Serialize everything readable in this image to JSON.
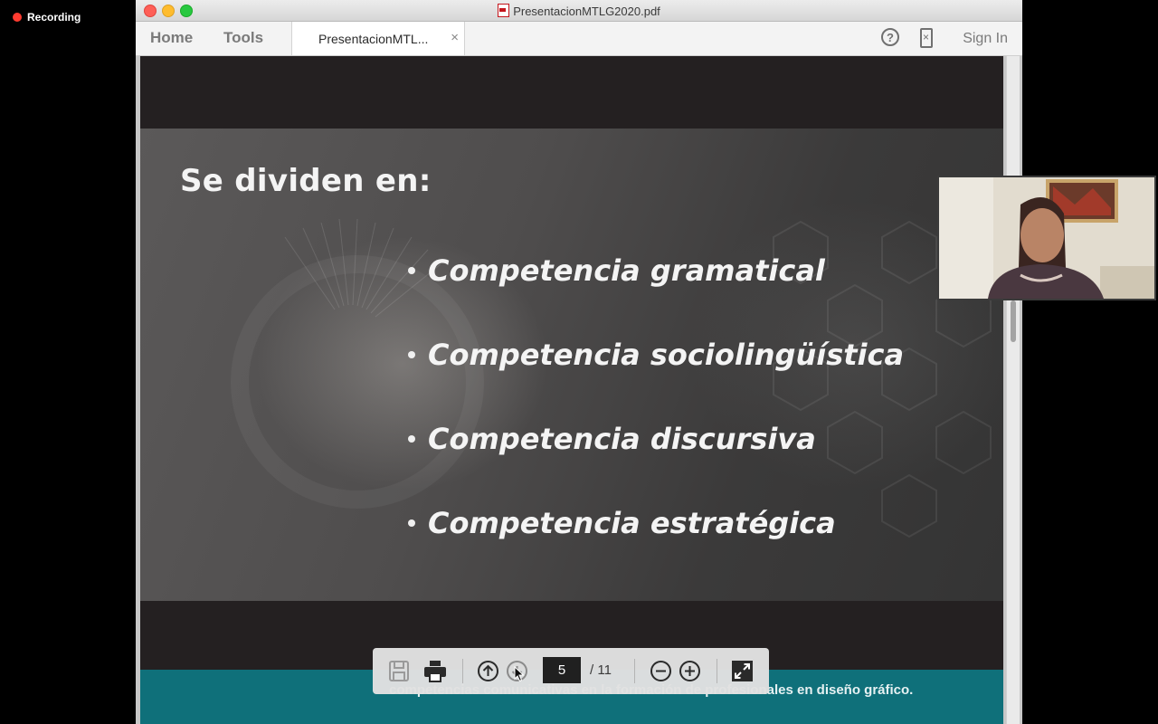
{
  "recording": {
    "label": "Recording"
  },
  "window": {
    "title": "PresentacionMTLG2020.pdf"
  },
  "toolbar": {
    "home_label": "Home",
    "tools_label": "Tools",
    "doc_tab_label": "PresentacionMTL...",
    "doc_tab_close": "×",
    "help_glyph": "?",
    "signin_label": "Sign In"
  },
  "slide": {
    "heading": "Se dividen en:",
    "bullets": [
      "Competencia gramatical",
      "Competencia sociolingüística",
      "Competencia discursiva",
      "Competencia estratégica"
    ],
    "footer_text": "competencias comunicativas en la formación de profesionales en diseño gráfico.",
    "footer_color": "#0f707a"
  },
  "pagebar": {
    "current_page": "5",
    "total_pages": "/ 11"
  },
  "icons": {
    "save": "save-icon",
    "print": "print-icon",
    "prev": "arrow-up-circle-icon",
    "next": "arrow-down-circle-icon",
    "zoom_out": "zoom-out-icon",
    "zoom_in": "zoom-in-icon",
    "fit": "fit-page-icon"
  }
}
